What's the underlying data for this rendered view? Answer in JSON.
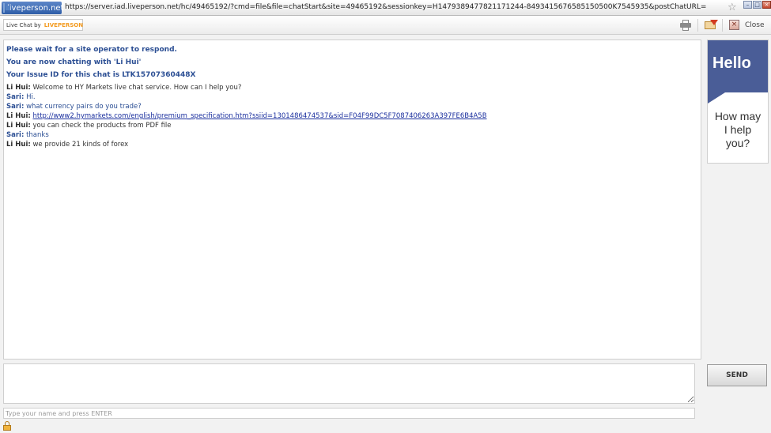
{
  "browser": {
    "site_label": "liveperson.net",
    "url": "https://server.iad.liveperson.net/hc/49465192/?cmd=file&file=chatStart&site=49465192&sessionkey=H1479389477821171244-8493415676585150500K7545935&postChatURL="
  },
  "toolbar": {
    "logo_prefix": "Live Chat by",
    "logo_brand": "LIVEPERSON",
    "close_label": "Close"
  },
  "transcript": {
    "system": [
      "Please wait for a site operator to respond.",
      "You are now chatting with 'Li Hui'",
      "Your Issue ID for this chat is LTK15707360448X"
    ],
    "messages": [
      {
        "who": "Li Hui:",
        "text": "Welcome to HY Markets live chat service. How can I help you?"
      },
      {
        "who": "Sari:",
        "text": "Hi."
      },
      {
        "who": "Sari:",
        "text": "what currency pairs do you trade?"
      },
      {
        "who": "Li Hui:",
        "text": "http://www2.hymarkets.com/english/premium_specification.htm?ssiid=1301486474537&sid=F04F99DC5F7087406263A397FE6B4A5B"
      },
      {
        "who": "Li Hui:",
        "text": "you can check the products from PDF file"
      },
      {
        "who": "Sari:",
        "text": "thanks"
      },
      {
        "who": "Li Hui:",
        "text": "we provide 21 kinds of forex"
      }
    ]
  },
  "ad": {
    "headline": "Hello",
    "line1": "How may",
    "line2": "I help",
    "line3": "you?",
    "color": "#4a5d97"
  },
  "composer": {
    "send_label": "SEND",
    "name_placeholder": "Type your name and press ENTER"
  }
}
